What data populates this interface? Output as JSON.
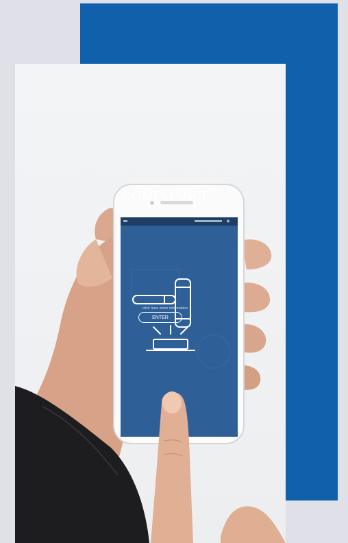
{
  "panel": {
    "color": "#1060ac"
  },
  "phone_screen": {
    "title": "COMPLIANCE",
    "hint": "click here more information",
    "button_label": "ENTER",
    "icon": "gavel-icon",
    "color": "#2e5f96"
  }
}
